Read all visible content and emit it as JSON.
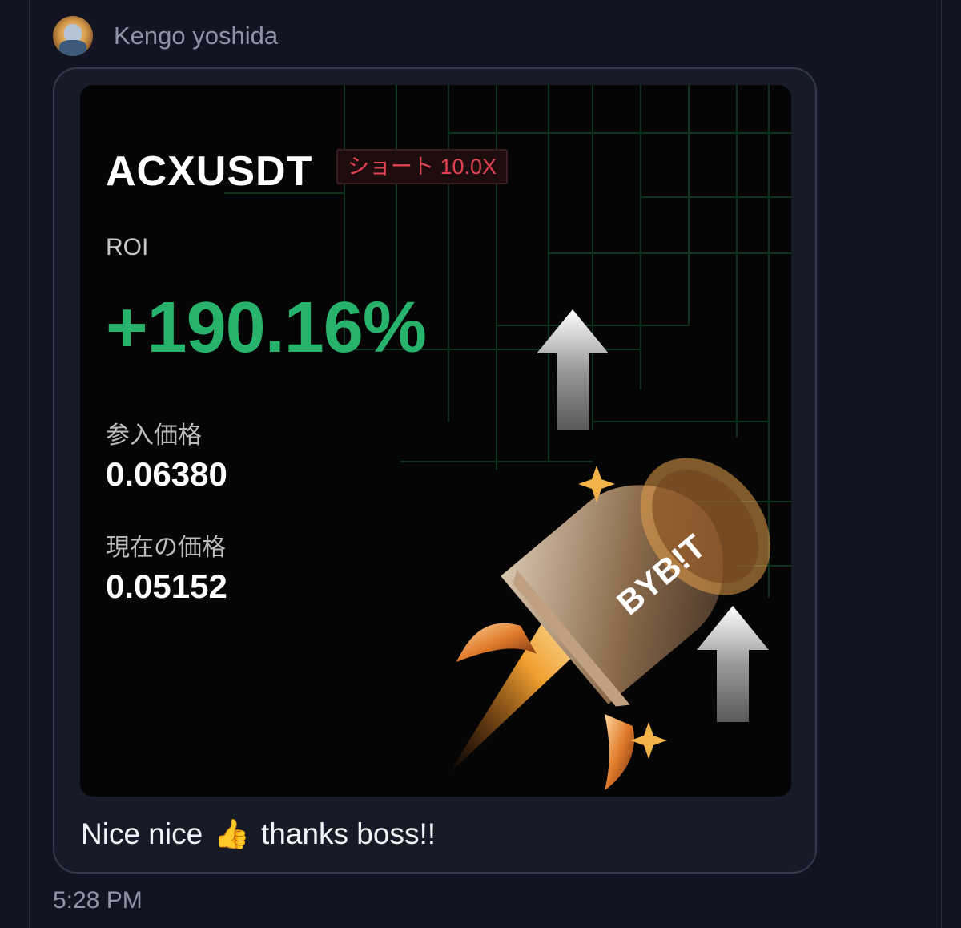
{
  "message": {
    "author": "Kengo yoshida",
    "text_before": "Nice nice",
    "emoji": "👍",
    "text_after": "thanks boss!!",
    "time": "5:28 PM",
    "avatar_icon": "user-avatar-icon"
  },
  "card": {
    "pair": "ACXUSDT",
    "side_badge": "ショート 10.0X",
    "roi_label": "ROI",
    "roi_value": "+190.16%",
    "entry_label": "参入価格",
    "entry_value": "0.06380",
    "current_label": "現在の価格",
    "current_value": "0.05152",
    "brand": "BYB!T"
  },
  "colors": {
    "background": "#121521",
    "bubble_border": "#343a49",
    "roi_green": "#27b36b",
    "badge_red": "#e2414f",
    "muted_text": "#8e94a3"
  }
}
